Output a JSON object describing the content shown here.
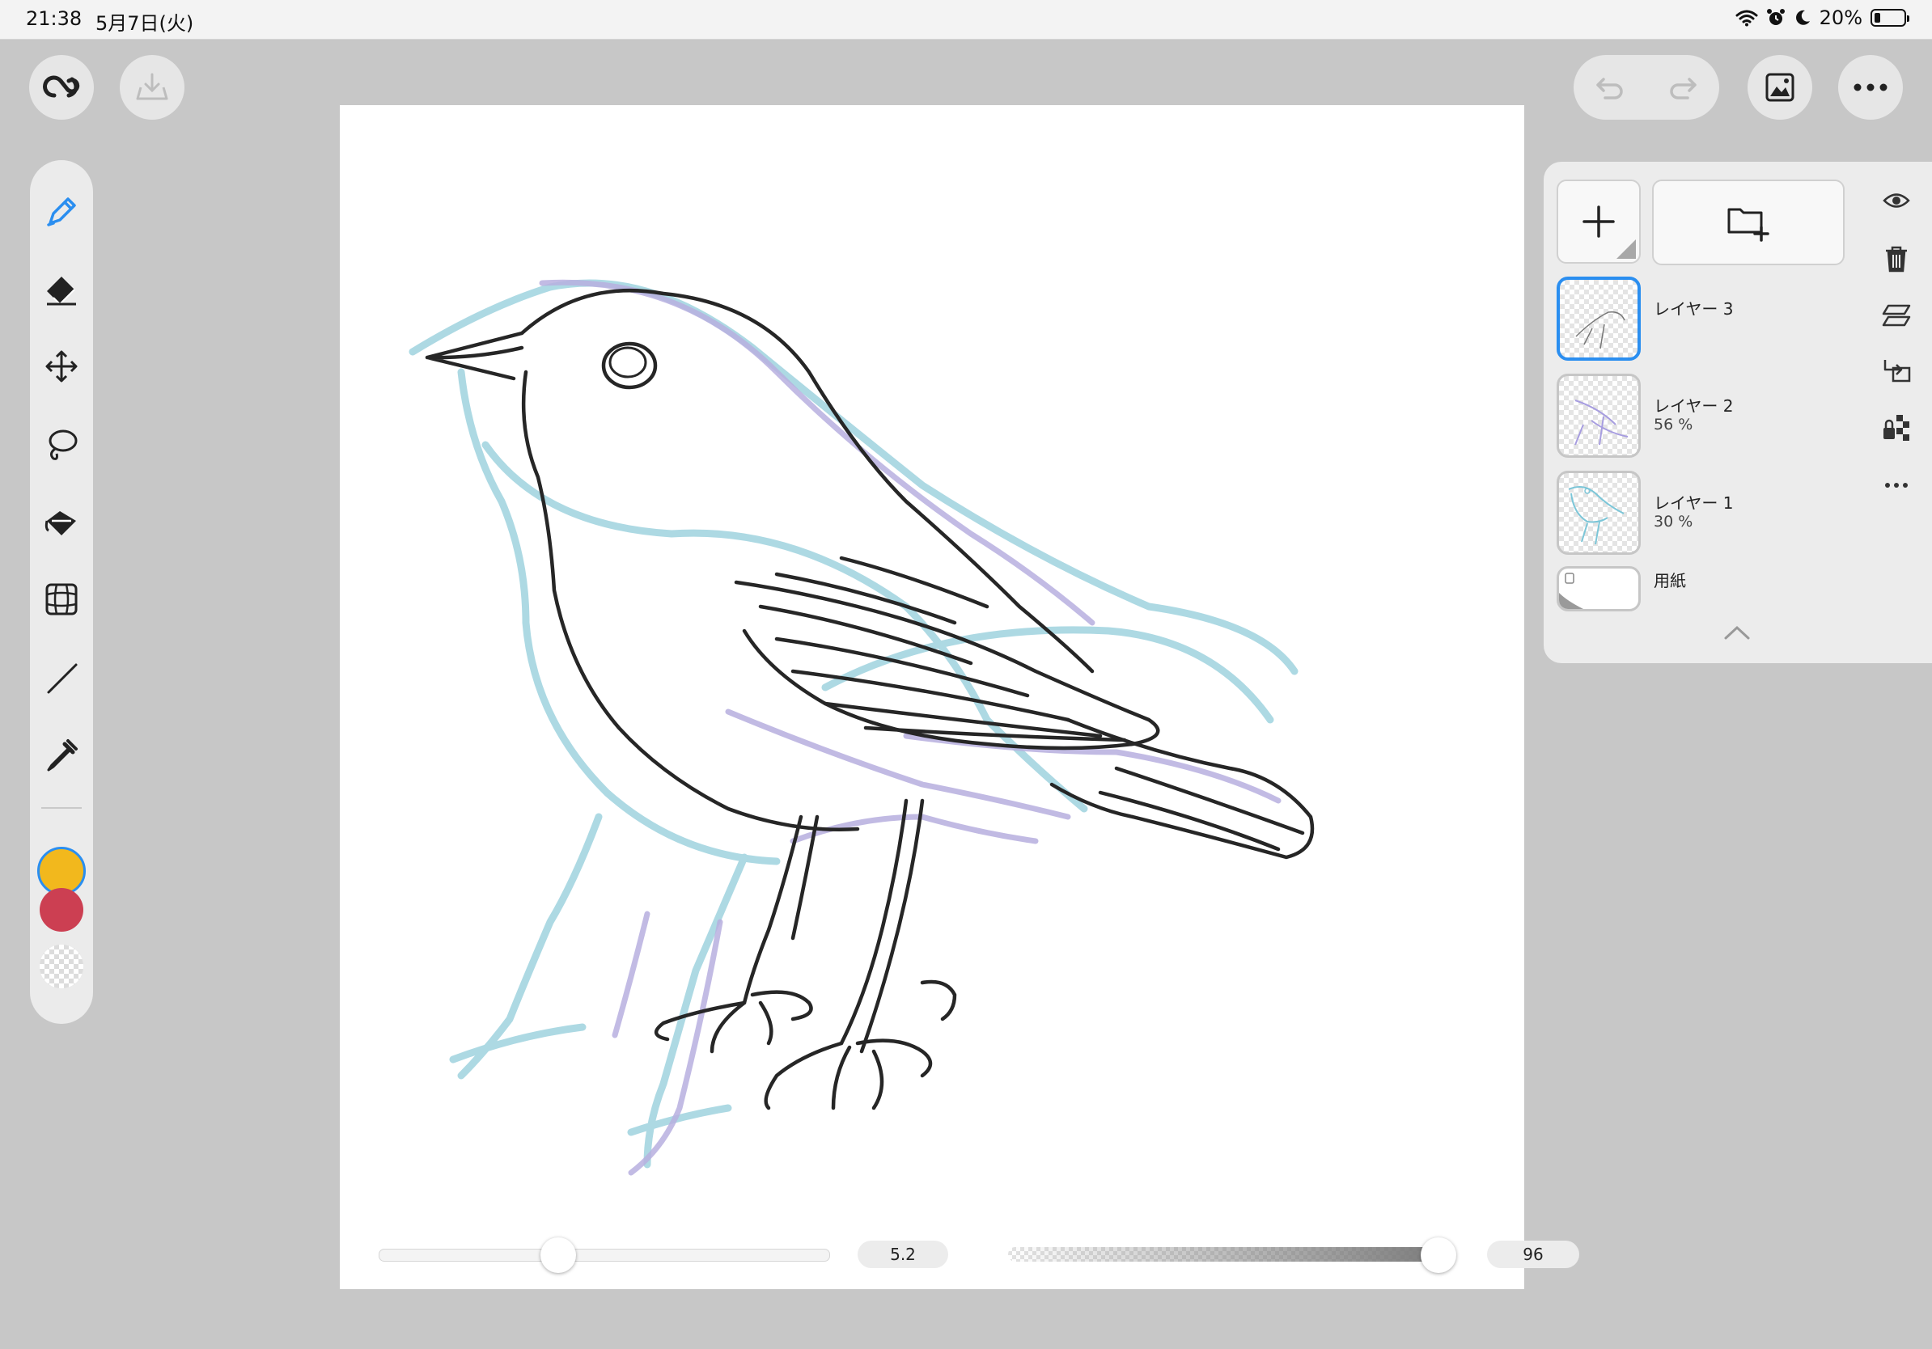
{
  "status_bar": {
    "time": "21:38",
    "date": "5月7日(火)",
    "battery": "20%",
    "battery_level": 0.2
  },
  "top_bar": {
    "left_buttons": [
      "creative-cloud-icon",
      "export-icon"
    ],
    "right_buttons": [
      "undo-icon",
      "redo-icon",
      "gallery-icon",
      "more-icon"
    ]
  },
  "toolbar": {
    "tools": [
      "brush-icon",
      "eraser-icon",
      "move-icon",
      "lasso-icon",
      "fill-icon",
      "perspective-grid-icon",
      "line-icon",
      "eyedropper-icon"
    ],
    "primary_color": "#f2b81d",
    "secondary_color": "#cc3f52",
    "accent_color": "#2a8ef0"
  },
  "sliders": {
    "brush_size": "5.2",
    "brush_size_level": 0.4,
    "opacity": "96",
    "opacity_level": 0.96
  },
  "layers": {
    "items": [
      {
        "name": "レイヤー 3",
        "opacity": ""
      },
      {
        "name": "レイヤー 2",
        "opacity": "56 %"
      },
      {
        "name": "レイヤー 1",
        "opacity": "30 %"
      }
    ],
    "paper": "用紙"
  }
}
